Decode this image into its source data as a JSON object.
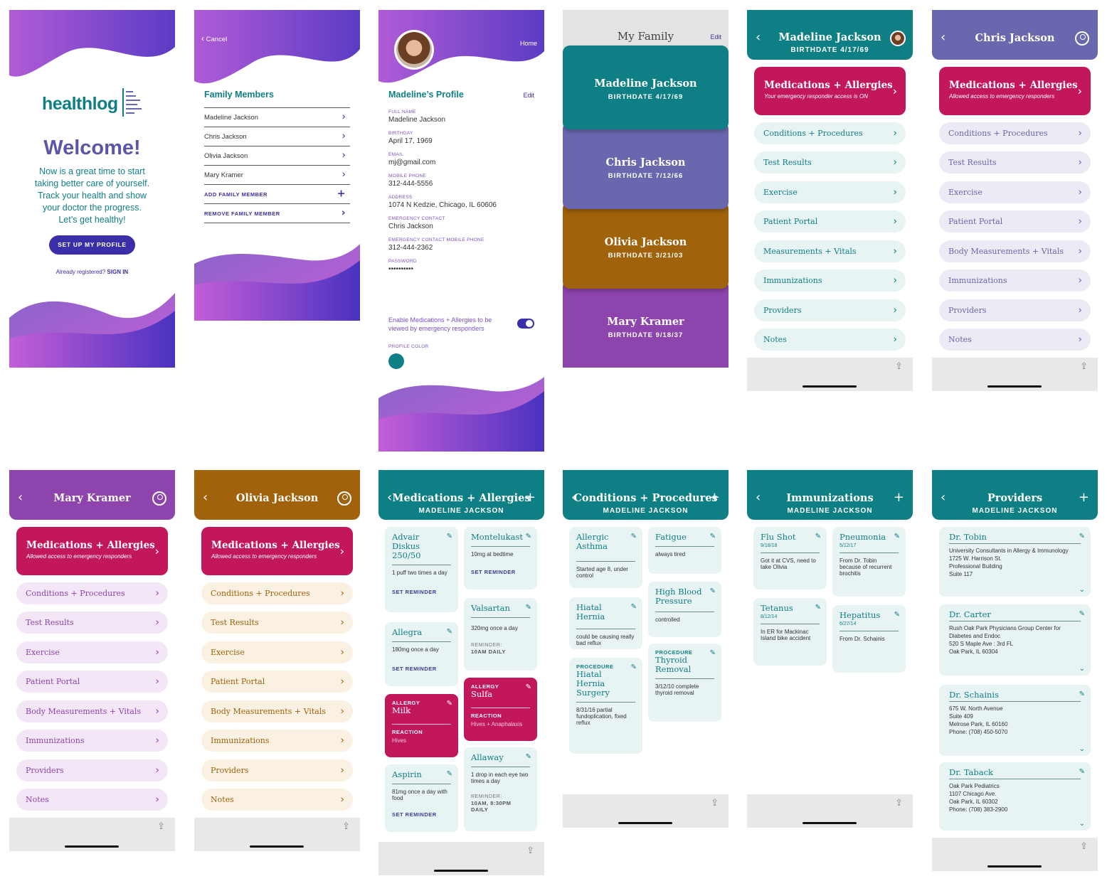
{
  "welcome": {
    "logo": "healthlog",
    "title": "Welcome!",
    "lines": [
      "Now is a great time to start",
      "taking better care of yourself.",
      "Track your health and show",
      "your doctor the progress.",
      "Let’s get healthy!"
    ],
    "button": "SET UP MY PROFILE",
    "already": "Already registered?",
    "signin": "SIGN IN"
  },
  "family_members": {
    "cancel": "Cancel",
    "heading": "Family Members",
    "members": [
      "Madeline Jackson",
      "Chris Jackson",
      "Olivia Jackson",
      "Mary Kramer"
    ],
    "add": "ADD FAMILY MEMBER",
    "remove": "REMOVE FAMILY MEMBER"
  },
  "profile": {
    "home": "Home",
    "title": "Madeline’s Profile",
    "edit": "Edit",
    "fields": [
      {
        "label": "FULL NAME",
        "value": "Madeline Jackson"
      },
      {
        "label": "BIRTHDAY",
        "value": "April 17, 1969"
      },
      {
        "label": "EMAIL",
        "value": "mj@gmail.com"
      },
      {
        "label": "MOBILE PHONE",
        "value": "312-444-5556"
      },
      {
        "label": "ADDRESS",
        "value": "1074  N Kedzie, Chicago, IL 60606"
      },
      {
        "label": "EMERGENCY CONTACT",
        "value": "Chris Jackson"
      },
      {
        "label": "EMERGENCY CONTACT MOBILE PHONE",
        "value": "312-444-2362"
      },
      {
        "label": "PASSWORD",
        "value": "••••••••••"
      }
    ],
    "toggle_label": "Enable Medications + Allergies to be viewed by emergency responders",
    "color_label": "PROFILE COLOR",
    "profile_color": "#0f7f86"
  },
  "my_family": {
    "title": "My Family",
    "edit": "Edit",
    "members": [
      {
        "name": "Madeline Jackson",
        "bd": "BIRTHDATE 4/17/69",
        "color": "#0f7f86"
      },
      {
        "name": "Chris Jackson",
        "bd": "BIRTHDATE 7/12/66",
        "color": "#6967ad"
      },
      {
        "name": "Olivia Jackson",
        "bd": "BIRTHDATE 3/21/03",
        "color": "#a0620a"
      },
      {
        "name": "Mary Kramer",
        "bd": "BIRTHDATE 9/18/37",
        "color": "#8e44ad"
      }
    ]
  },
  "dash_madeline": {
    "name": "Madeline Jackson",
    "sub": "BIRTHDATE 4/17/69",
    "ma": "Medications + Allergies",
    "ma_sub": "Your emergency responder access is ON",
    "items": [
      "Conditions + Procedures",
      "Test Results",
      "Exercise",
      "Patient Portal",
      "Measurements + Vitals",
      "Immunizations",
      "Providers",
      "Notes"
    ]
  },
  "dash_chris": {
    "name": "Chris Jackson",
    "ma": "Medications + Allergies",
    "ma_sub": "Allowed access to emergency responders",
    "items": [
      "Conditions + Procedures",
      "Test Results",
      "Exercise",
      "Patient Portal",
      "Body Measurements + Vitals",
      "Immunizations",
      "Providers",
      "Notes"
    ]
  },
  "dash_mary": {
    "name": "Mary Kramer",
    "ma": "Medications + Allergies",
    "ma_sub": "Allowed access to emergency responders",
    "items": [
      "Conditions + Procedures",
      "Test Results",
      "Exercise",
      "Patient Portal",
      "Body Measurements + Vitals",
      "Immunizations",
      "Providers",
      "Notes"
    ]
  },
  "dash_olivia": {
    "name": "Olivia Jackson",
    "ma": "Medications + Allergies",
    "ma_sub": "Allowed access to emergency responders",
    "items": [
      "Conditions + Procedures",
      "Test Results",
      "Exercise",
      "Patient Portal",
      "Body Measurements + Vitals",
      "Immunizations",
      "Providers",
      "Notes"
    ]
  },
  "meds": {
    "title": "Medications + Allergies",
    "sub": "MADELINE JACKSON",
    "advair": {
      "name": "Advair Diskus 250/50",
      "dose": "1 puff two times a day",
      "rem": "SET REMINDER"
    },
    "allegra": {
      "name": "Allegra",
      "dose": "180mg once a day",
      "rem": "SET REMINDER"
    },
    "milk": {
      "tag": "ALLERGY",
      "name": "Milk",
      "rlabel": "REACTION",
      "reaction": "Hives"
    },
    "aspirin": {
      "name": "Aspirin",
      "dose": "81mg once a day with food",
      "rem": "SET REMINDER"
    },
    "montelukast": {
      "name": "Montelukast",
      "dose": "10mg at bedtime",
      "rem": "SET REMINDER"
    },
    "valsartan": {
      "name": "Valsartan",
      "dose": "320mg once a day",
      "rlabel": "REMINDER:",
      "rem": "10AM DAILY"
    },
    "sulfa": {
      "tag": "ALLERGY",
      "name": "Sulfa",
      "rlabel": "REACTION",
      "reaction": "Hives + Anaphalaxis"
    },
    "allaway": {
      "name": "Allaway",
      "dose": "1 drop in each eye two times a day",
      "rlabel": "REMINDER:",
      "rem": "10AM, 8:30PM DAILY"
    }
  },
  "conditions": {
    "title": "Conditions + Procedures",
    "sub": "MADELINE JACKSON",
    "asthma": {
      "name": "Allergic Asthma",
      "note": "Started age 8, under control"
    },
    "hernia": {
      "name": "Hiatal Hernia",
      "note": "could be causing really bad reflux"
    },
    "surgery": {
      "tag": "PROCEDURE",
      "name": "Hiatal Hernia Surgery",
      "note": "8/31/16 partial fundoplication, fixed reflux"
    },
    "fatigue": {
      "name": "Fatigue",
      "note": "always tired"
    },
    "hbp": {
      "name": "High Blood Pressure",
      "note": "controlled"
    },
    "thyroid": {
      "tag": "PROCEDURE",
      "name": "Thyroid Removal",
      "note": "3/12/10 complete thyroid removal"
    }
  },
  "immunizations": {
    "title": "Immunizations",
    "sub": "MADELINE JACKSON",
    "flu": {
      "name": "Flu Shot",
      "date": "9/18/18",
      "note": "Got it at CVS, need to take Olivia"
    },
    "tetanus": {
      "name": "Tetanus",
      "date": "8/12/14",
      "note": "In ER for Mackinac Island bike accident"
    },
    "pneumonia": {
      "name": "Pneumonia",
      "date": "5/12/17",
      "note": "From Dr. Tobin because of recurrent brochitis"
    },
    "hepatitus": {
      "name": "Hepatitus",
      "date": "6/27/14",
      "note": "From Dr. Schainis"
    }
  },
  "providers": {
    "title": "Providers",
    "sub": "MADELINE JACKSON",
    "list": [
      {
        "name": "Dr. Tobin",
        "lines": [
          "University Consultants in Allergy & Immunology",
          "1725 W. Harrison St.",
          "Professional Building",
          "Suite 117"
        ]
      },
      {
        "name": "Dr. Carter",
        "lines": [
          "Rush Oak Park Physicians Group Center for Diabetes and Endoc",
          "520 S Maple Ave : 3rd FL",
          "Oak Park, IL 60304"
        ]
      },
      {
        "name": "Dr. Schainis",
        "lines": [
          "675 W. North Avenue",
          "Suite 409",
          "Melrose Park, IL 60160",
          "Phone: (708) 450-5070"
        ]
      },
      {
        "name": "Dr. Taback",
        "lines": [
          "Oak Park Pediatrics",
          "1107 Chicago Ave.",
          "Oak Park, IL 60302",
          "Phone: (708) 383-2900"
        ]
      }
    ]
  },
  "colors": {
    "teal": "#0f7f86",
    "purple": "#6967ad",
    "orange": "#a0620a",
    "violet": "#8e44ad",
    "crimson": "#c2185b"
  },
  "icons": [
    "chevron-right-icon",
    "back-icon",
    "plus-icon",
    "pencil-icon",
    "share-icon",
    "user-icon",
    "chevron-down-icon"
  ]
}
